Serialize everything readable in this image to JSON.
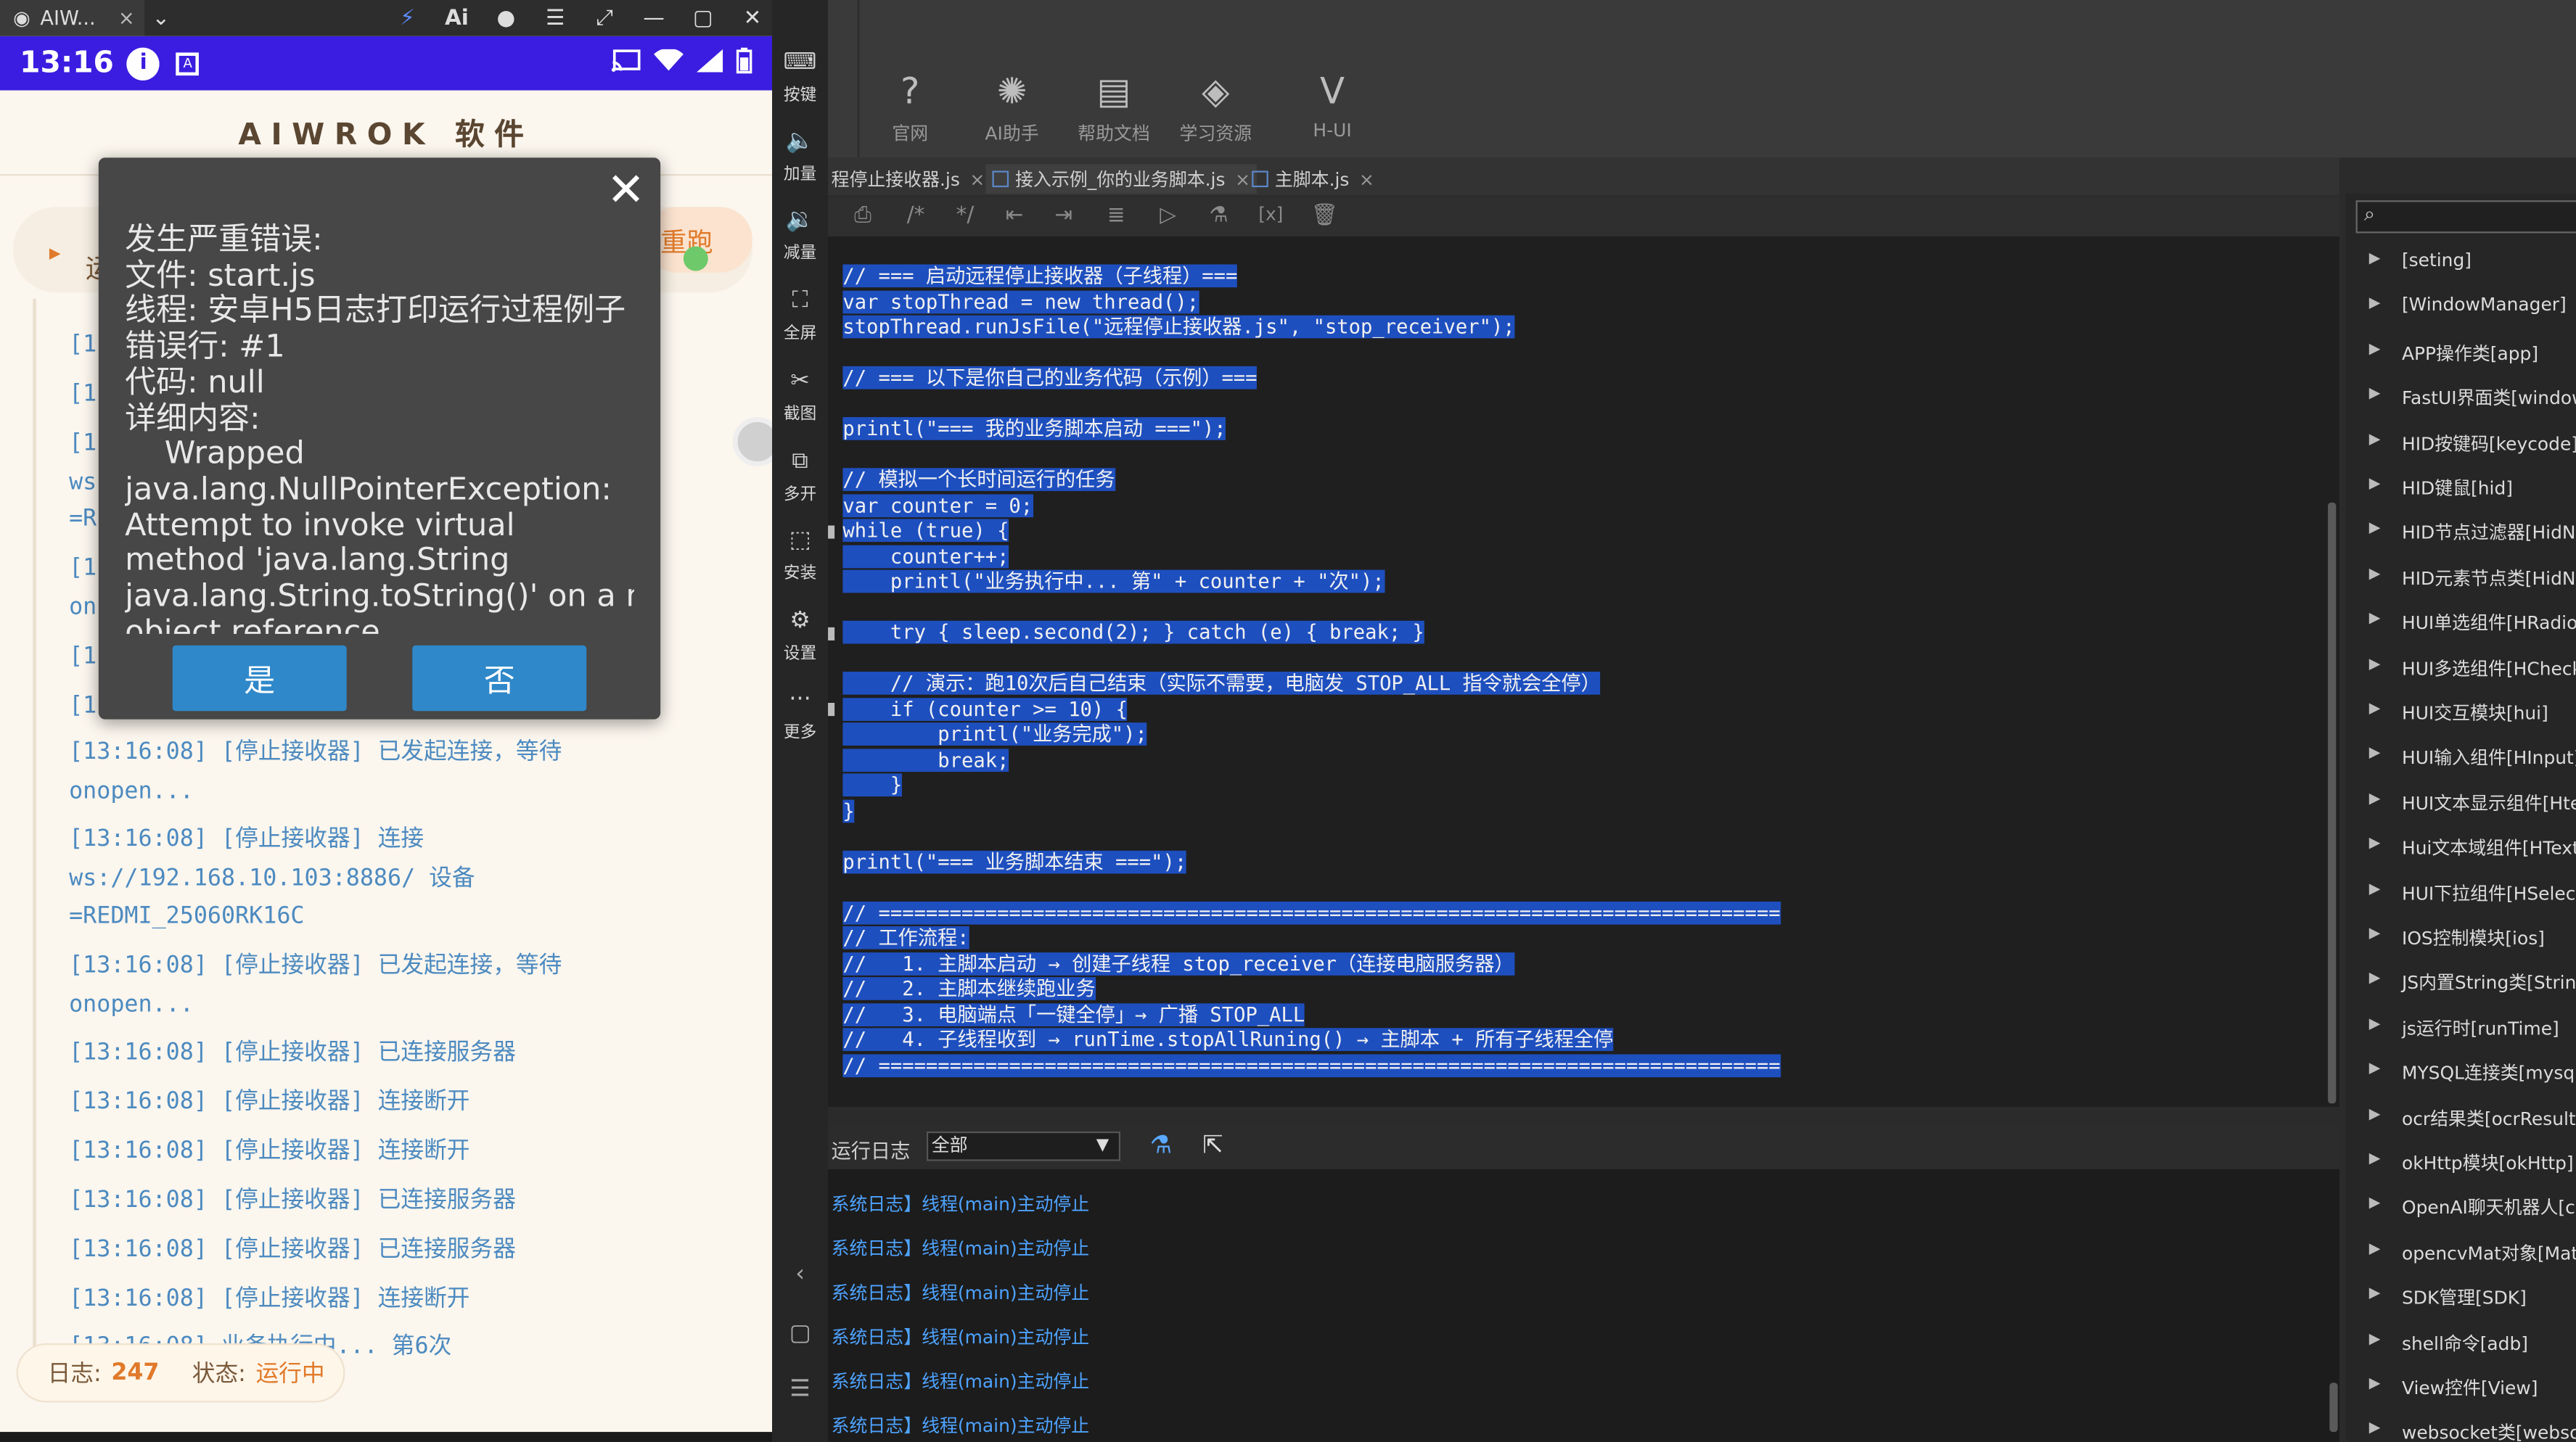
{
  "window": {
    "tab_title": "AIW...",
    "tab_close": "×",
    "titlebar_icons": [
      "⌄",
      "⚡",
      "Ai",
      "●",
      "☰",
      "⤢",
      "—",
      "▢",
      "✕",
      "«"
    ]
  },
  "phone": {
    "status": {
      "time": "13:16",
      "info_glyph": "i",
      "a_glyph": "A"
    },
    "app_title": "AIWROK 软件",
    "control": {
      "partial_text": "运",
      "rerun_label": "重跑"
    },
    "logs": [
      {
        "text": "[1"
      },
      {
        "text": "[1"
      },
      {
        "text": "[1"
      },
      {
        "text": "ws"
      },
      {
        "text": "=R"
      },
      {
        "text": "[1"
      },
      {
        "text": "on"
      },
      {
        "text": "[1"
      },
      {
        "text": "[1"
      },
      {
        "text": "[13:16:08] [停止接收器] 已发起连接，等待"
      },
      {
        "text": "onopen..."
      },
      {
        "text": "[13:16:08] [停止接收器] 连接"
      },
      {
        "text": "ws://192.168.10.103:8886/ 设备"
      },
      {
        "text": "=REDMI_25060RK16C"
      },
      {
        "text": "[13:16:08] [停止接收器] 已发起连接，等待"
      },
      {
        "text": "onopen..."
      },
      {
        "text": "[13:16:08] [停止接收器] 已连接服务器"
      },
      {
        "text": "[13:16:08] [停止接收器] 连接断开"
      },
      {
        "text": "[13:16:08] [停止接收器] 连接断开"
      },
      {
        "text": "[13:16:08] [停止接收器] 已连接服务器"
      },
      {
        "text": "[13:16:08] [停止接收器] 已连接服务器"
      },
      {
        "text": "[13:16:08] [停止接收器] 连接断开"
      },
      {
        "text": "[13:16:08] 业务执行中... 第6次"
      }
    ],
    "stats": {
      "log_label": "日志:",
      "log_count": "247",
      "status_label": "状态:",
      "status_value": "运行中"
    },
    "dialog": {
      "lines": [
        "发生严重错误:",
        "文件: start.js",
        "线程: 安卓H5日志打印运行过程例子",
        "错误行: #1",
        "代码: null",
        "详细内容:",
        "    Wrapped",
        "java.lang.NullPointerException:",
        "Attempt to invoke virtual",
        "method 'java.lang.String",
        "java.lang.String.toString()' on a null",
        "object reference"
      ],
      "yes_label": "是",
      "no_label": "否",
      "close_glyph": "✕"
    }
  },
  "sidebar": {
    "items": [
      {
        "icon": "⌨",
        "label": "按键"
      },
      {
        "icon": "🔈",
        "label": "加量"
      },
      {
        "icon": "🔉",
        "label": "减量"
      },
      {
        "icon": "⛶",
        "label": "全屏"
      },
      {
        "icon": "✂",
        "label": "截图"
      },
      {
        "icon": "⧉",
        "label": "多开"
      },
      {
        "icon": "⬚",
        "label": "安装"
      },
      {
        "icon": "⚙",
        "label": "设置"
      },
      {
        "icon": "···",
        "label": "更多"
      }
    ],
    "nav": [
      "‹",
      "▢",
      "☰"
    ]
  },
  "ide": {
    "top_buttons": [
      {
        "icon": "?",
        "label": "官网"
      },
      {
        "icon": "✺",
        "label": "AI助手"
      },
      {
        "icon": "▤",
        "label": "帮助文档"
      },
      {
        "icon": "◈",
        "label": "学习资源"
      },
      {
        "icon": "V",
        "label": "H-UI"
      }
    ],
    "tabs": [
      {
        "label": "程停止接收器.js",
        "close": "×"
      },
      {
        "label": "接入示例_你的业务脚本.js",
        "close": "×"
      },
      {
        "label": "主脚本.js",
        "close": "×"
      }
    ],
    "tools": [
      "⎙",
      "/*",
      "*/",
      "⇤",
      "⇥",
      "≣",
      "▷",
      "⚗",
      "[x]",
      "🗑"
    ],
    "code": [
      "",
      "// === 启动远程停止接收器（子线程）===",
      "var stopThread = new thread();",
      "stopThread.runJsFile(\"远程停止接收器.js\", \"stop_receiver\");",
      "",
      "// === 以下是你自己的业务代码（示例）===",
      "",
      "printl(\"=== 我的业务脚本启动 ===\");",
      "",
      "// 模拟一个长时间运行的任务",
      "var counter = 0;",
      "while (true) {",
      "    counter++;",
      "    printl(\"业务执行中... 第\" + counter + \"次\");",
      "",
      "    try { sleep.second(2); } catch (e) { break; }",
      "",
      "    // 演示：跑10次后自己结束（实际不需要，电脑发 STOP_ALL 指令就会全停）",
      "    if (counter >= 10) {",
      "        printl(\"业务完成\");",
      "        break;",
      "    }",
      "}",
      "",
      "printl(\"=== 业务脚本结束 ===\");",
      "",
      "// ============================================================================",
      "// 工作流程:",
      "//   1. 主脚本启动 → 创建子线程 stop_receiver（连接电脑服务器）",
      "//   2. 主脚本继续跑业务",
      "//   3. 电脑端点「一键全停」→ 广播 STOP_ALL",
      "//   4. 子线程收到 → runTime.stopAllRuning() → 主脚本 + 所有子线程全停",
      "// ============================================================================"
    ],
    "log": {
      "label": "运行日志",
      "filter_value": "全部",
      "filter_arrow": "▼",
      "clear_icon": "⚗",
      "export_icon": "⇱",
      "lines": [
        "系统日志】线程(main)主动停止",
        "系统日志】线程(main)主动停止",
        "系统日志】线程(main)主动停止",
        "系统日志】线程(main)主动停止",
        "系统日志】线程(main)主动停止",
        "系统日志】线程(main)主动停止"
      ]
    },
    "api": {
      "search_icon": "⌕",
      "items": [
        "[seting]",
        "[WindowManager]",
        "APP操作类[app]",
        "FastUI界面类[window",
        "HID按键码[keycode]",
        "HID键鼠[hid]",
        "HID节点过滤器[HidNo",
        "HID元素节点类[HidNo",
        "HUI单选组件[HRadio]",
        "HUI多选组件[HCheck",
        "HUI交互模块[hui]",
        "HUI输入组件[HInput]",
        "HUI文本显示组件[Hte",
        "Hui文本域组件[HText",
        "HUI下拉组件[HSelect]",
        "IOS控制模块[ios]",
        "JS内置String类[String",
        "js运行时[runTime]",
        "MYSQL连接类[mysql]",
        "ocr结果类[ocrResult]",
        "okHttp模块[okHttp]",
        "OpenAI聊天机器人[ch",
        "opencvMat对象[Mat]",
        "SDK管理[SDK]",
        "shell命令[adb]",
        "View控件[View]",
        "websocket类[websoc"
      ]
    }
  }
}
